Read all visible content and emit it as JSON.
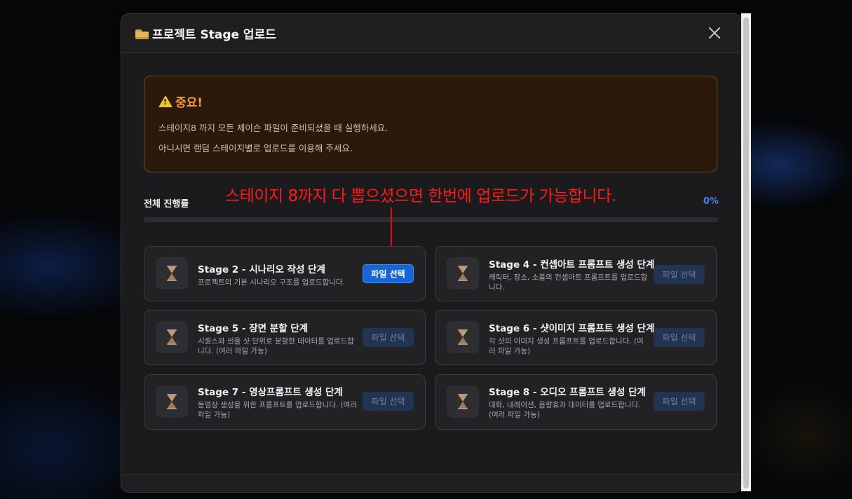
{
  "modal": {
    "title": "프로젝트 Stage 업로드",
    "title_icon": "folder-icon",
    "close_icon": "close-icon"
  },
  "warning": {
    "title": "중요!",
    "icon": "warning-icon",
    "line1": "스테이지8 까지 모든 제이슨 파일이 준비되셨을 때 실행하세요.",
    "line2": "아니시면 랜덤 스테이지별로 업로드를 이용해 주세요."
  },
  "annotation": {
    "text": "스테이지 8까지 다 뽑으셨으면 한번에 업로드가 가능합니다.",
    "color": "#ff1a1a"
  },
  "progress": {
    "label": "전체 진행률",
    "percent_text": "0%",
    "value": 0
  },
  "stages": [
    {
      "title": "Stage 2 - 시나리오 작성 단계",
      "desc": "프로젝트의 기본 시나리오 구조를 업로드합니다.",
      "button": "파일 선택",
      "enabled": true,
      "icon": "hourglass-icon"
    },
    {
      "title": "Stage 4 - 컨셉아트 프롬프트 생성 단계",
      "desc": "캐릭터, 장소, 소품의 컨셉아트 프롬프트를 업로드합니다.",
      "button": "파일 선택",
      "enabled": false,
      "icon": "hourglass-icon"
    },
    {
      "title": "Stage 5 - 장면 분할 단계",
      "desc": "시퀀스와 씬을 샷 단위로 분할한 데이터를 업로드합니다. (여러 파일 가능)",
      "button": "파일 선택",
      "enabled": false,
      "icon": "hourglass-icon"
    },
    {
      "title": "Stage 6 - 샷이미지 프롬프트 생성 단계",
      "desc": "각 샷의 이미지 생성 프롬프트를 업로드합니다. (여러 파일 가능)",
      "button": "파일 선택",
      "enabled": false,
      "icon": "hourglass-icon"
    },
    {
      "title": "Stage 7 - 영상프롬프트 생성 단계",
      "desc": "동영상 생성을 위한 프롬프트를 업로드합니다. (여러 파일 가능)",
      "button": "파일 선택",
      "enabled": false,
      "icon": "hourglass-icon"
    },
    {
      "title": "Stage 8 - 오디오 프롬프트 생성 단계",
      "desc": "대화, 내레이션, 음향효과 데이터를 업로드합니다. (여러 파일 가능)",
      "button": "파일 선택",
      "enabled": false,
      "icon": "hourglass-icon"
    }
  ],
  "colors": {
    "accent": "#1766d6",
    "warning_text": "#f59a3c",
    "progress_text": "#4a7fe6"
  }
}
